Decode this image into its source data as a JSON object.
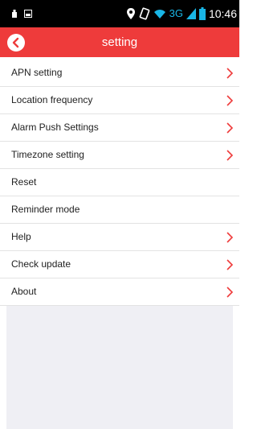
{
  "status_bar": {
    "time": "10:46",
    "network": "3G",
    "icons": [
      "usb-icon",
      "image-icon",
      "location-icon",
      "vibrate-icon",
      "wifi-icon",
      "signal-icon",
      "battery-icon"
    ]
  },
  "header": {
    "title": "setting",
    "back_icon": "back-icon"
  },
  "menu": {
    "items": [
      {
        "label": "APN setting",
        "chevron": true
      },
      {
        "label": "Location frequency",
        "chevron": true
      },
      {
        "label": "Alarm Push Settings",
        "chevron": true
      },
      {
        "label": "Timezone setting",
        "chevron": true
      },
      {
        "label": "Reset",
        "chevron": false
      },
      {
        "label": "Reminder mode",
        "chevron": false
      },
      {
        "label": "Help",
        "chevron": true
      },
      {
        "label": "Check update",
        "chevron": true
      },
      {
        "label": "About",
        "chevron": true
      }
    ]
  },
  "colors": {
    "accent": "#ee3b3b",
    "chevron": "#ee3b3b",
    "status_bar": "#000000",
    "network": "#19b6e6",
    "empty_area": "#efeff4"
  }
}
